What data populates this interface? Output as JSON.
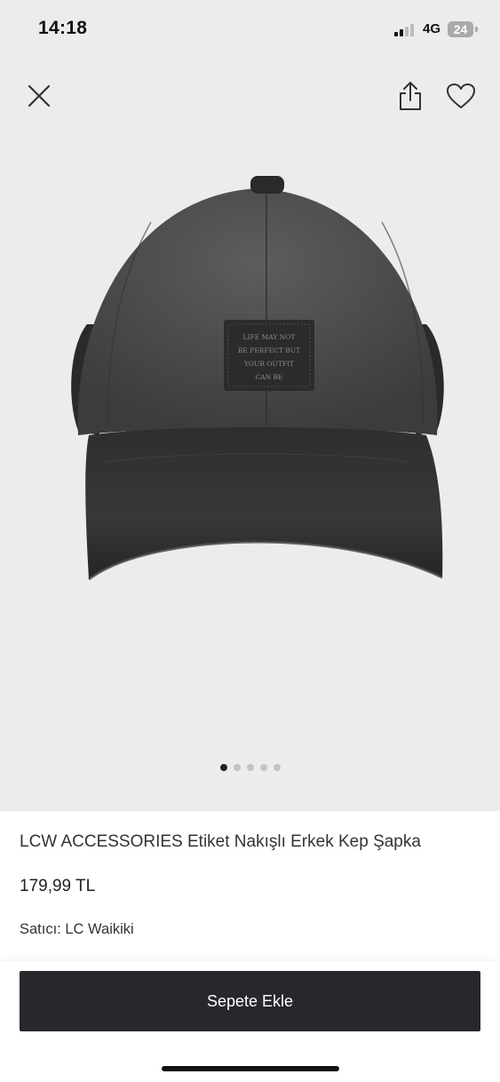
{
  "status_bar": {
    "time": "14:18",
    "network": "4G",
    "battery": "24"
  },
  "gallery": {
    "image_count": 5,
    "active_index": 0
  },
  "icons": {
    "close": "close-icon",
    "share": "share-icon",
    "favorite": "heart-icon"
  },
  "product": {
    "title": "LCW ACCESSORIES Etiket Nakışlı Erkek Kep Şapka",
    "price": "179,99 TL",
    "seller_label": "Satıcı:",
    "seller_name": "LC Waikiki",
    "patch_text": [
      "LIFE MAY NOT",
      "BE PERFECT BUT",
      "YOUR OUTFIT",
      "CAN BE"
    ]
  },
  "actions": {
    "add_to_cart_label": "Sepete Ekle"
  }
}
